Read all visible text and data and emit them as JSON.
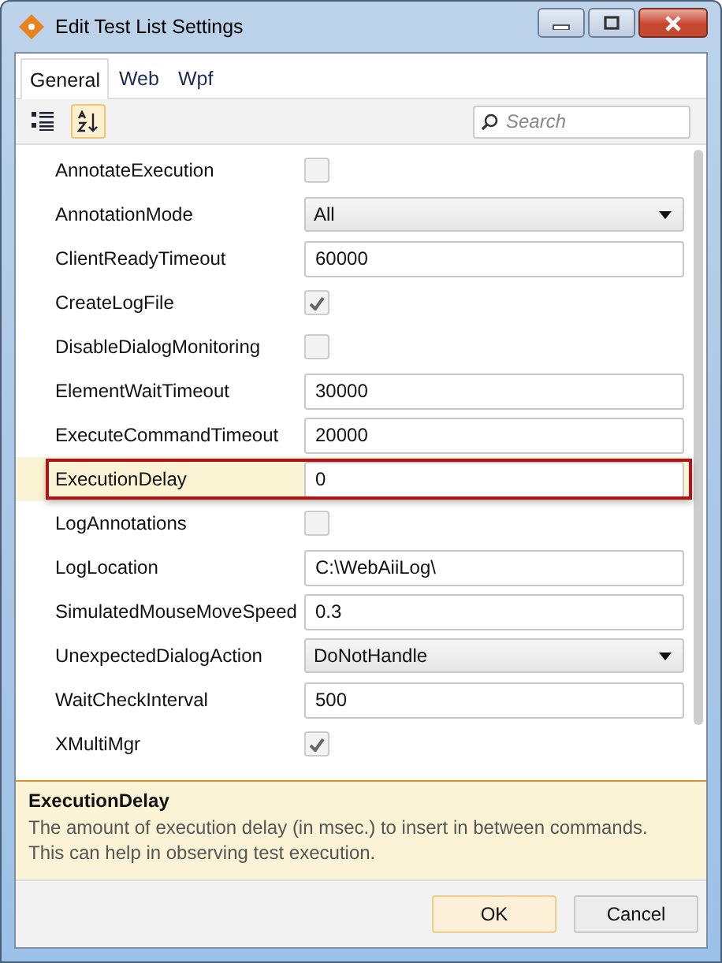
{
  "window": {
    "title": "Edit Test List Settings"
  },
  "tabs": [
    {
      "label": "General",
      "selected": true
    },
    {
      "label": "Web",
      "selected": false
    },
    {
      "label": "Wpf",
      "selected": false
    }
  ],
  "toolbar": {
    "categorized_selected": false,
    "alphabetical_selected": true
  },
  "search": {
    "placeholder": "Search"
  },
  "properties": [
    {
      "name": "AnnotateExecution",
      "kind": "checkbox",
      "checked": false,
      "selected": false
    },
    {
      "name": "AnnotationMode",
      "kind": "dropdown",
      "value": "All",
      "selected": false
    },
    {
      "name": "ClientReadyTimeout",
      "kind": "text",
      "value": "60000",
      "selected": false
    },
    {
      "name": "CreateLogFile",
      "kind": "checkbox",
      "checked": true,
      "selected": false
    },
    {
      "name": "DisableDialogMonitoring",
      "kind": "checkbox",
      "checked": false,
      "selected": false
    },
    {
      "name": "ElementWaitTimeout",
      "kind": "text",
      "value": "30000",
      "selected": false
    },
    {
      "name": "ExecuteCommandTimeout",
      "kind": "text",
      "value": "20000",
      "selected": false
    },
    {
      "name": "ExecutionDelay",
      "kind": "text",
      "value": "0",
      "selected": true
    },
    {
      "name": "LogAnnotations",
      "kind": "checkbox",
      "checked": false,
      "selected": false
    },
    {
      "name": "LogLocation",
      "kind": "text",
      "value": "C:\\WebAiiLog\\",
      "selected": false
    },
    {
      "name": "SimulatedMouseMoveSpeed",
      "kind": "text",
      "value": "0.3",
      "selected": false
    },
    {
      "name": "UnexpectedDialogAction",
      "kind": "dropdown",
      "value": "DoNotHandle",
      "selected": false
    },
    {
      "name": "WaitCheckInterval",
      "kind": "text",
      "value": "500",
      "selected": false
    },
    {
      "name": "XMultiMgr",
      "kind": "checkbox",
      "checked": true,
      "selected": false
    }
  ],
  "description": {
    "title": "ExecutionDelay",
    "text": "The amount of execution delay (in msec.) to insert in between commands. This can help in observing test execution."
  },
  "buttons": [
    {
      "label": "OK",
      "default": true
    },
    {
      "label": "Cancel",
      "default": false
    }
  ]
}
